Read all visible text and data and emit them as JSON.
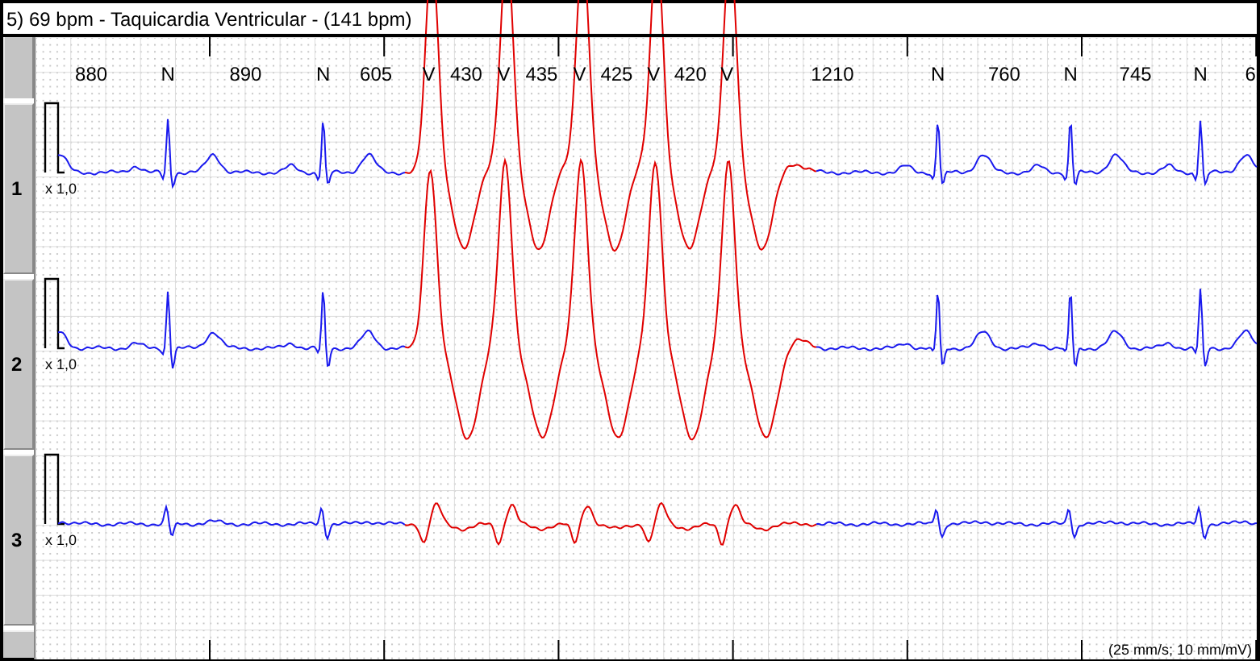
{
  "window": {
    "title": "5) 69 bpm - Taquicardia Ventricular - (141 bpm)"
  },
  "annotations": [
    {
      "kind": "interval",
      "text": "880"
    },
    {
      "kind": "beat",
      "text": "N",
      "ventricular": false
    },
    {
      "kind": "interval",
      "text": "890"
    },
    {
      "kind": "beat",
      "text": "N",
      "ventricular": false
    },
    {
      "kind": "interval",
      "text": "605"
    },
    {
      "kind": "beat",
      "text": "V",
      "ventricular": true
    },
    {
      "kind": "interval",
      "text": "430"
    },
    {
      "kind": "beat",
      "text": "V",
      "ventricular": true
    },
    {
      "kind": "interval",
      "text": "435"
    },
    {
      "kind": "beat",
      "text": "V",
      "ventricular": true
    },
    {
      "kind": "interval",
      "text": "425"
    },
    {
      "kind": "beat",
      "text": "V",
      "ventricular": true
    },
    {
      "kind": "interval",
      "text": "420"
    },
    {
      "kind": "beat",
      "text": "V",
      "ventricular": true
    },
    {
      "kind": "interval",
      "text": "1210"
    },
    {
      "kind": "beat",
      "text": "N",
      "ventricular": false
    },
    {
      "kind": "interval",
      "text": "760"
    },
    {
      "kind": "beat",
      "text": "N",
      "ventricular": false
    },
    {
      "kind": "interval",
      "text": "745"
    },
    {
      "kind": "beat",
      "text": "N",
      "ventricular": false
    },
    {
      "kind": "interval",
      "text": "6"
    }
  ],
  "leads": [
    {
      "label": "1",
      "gain": "x 1,0"
    },
    {
      "label": "2",
      "gain": "x 1,0"
    },
    {
      "label": "3",
      "gain": "x 1,0"
    }
  ],
  "scale": "(25 mm/s; 10 mm/mV)"
}
